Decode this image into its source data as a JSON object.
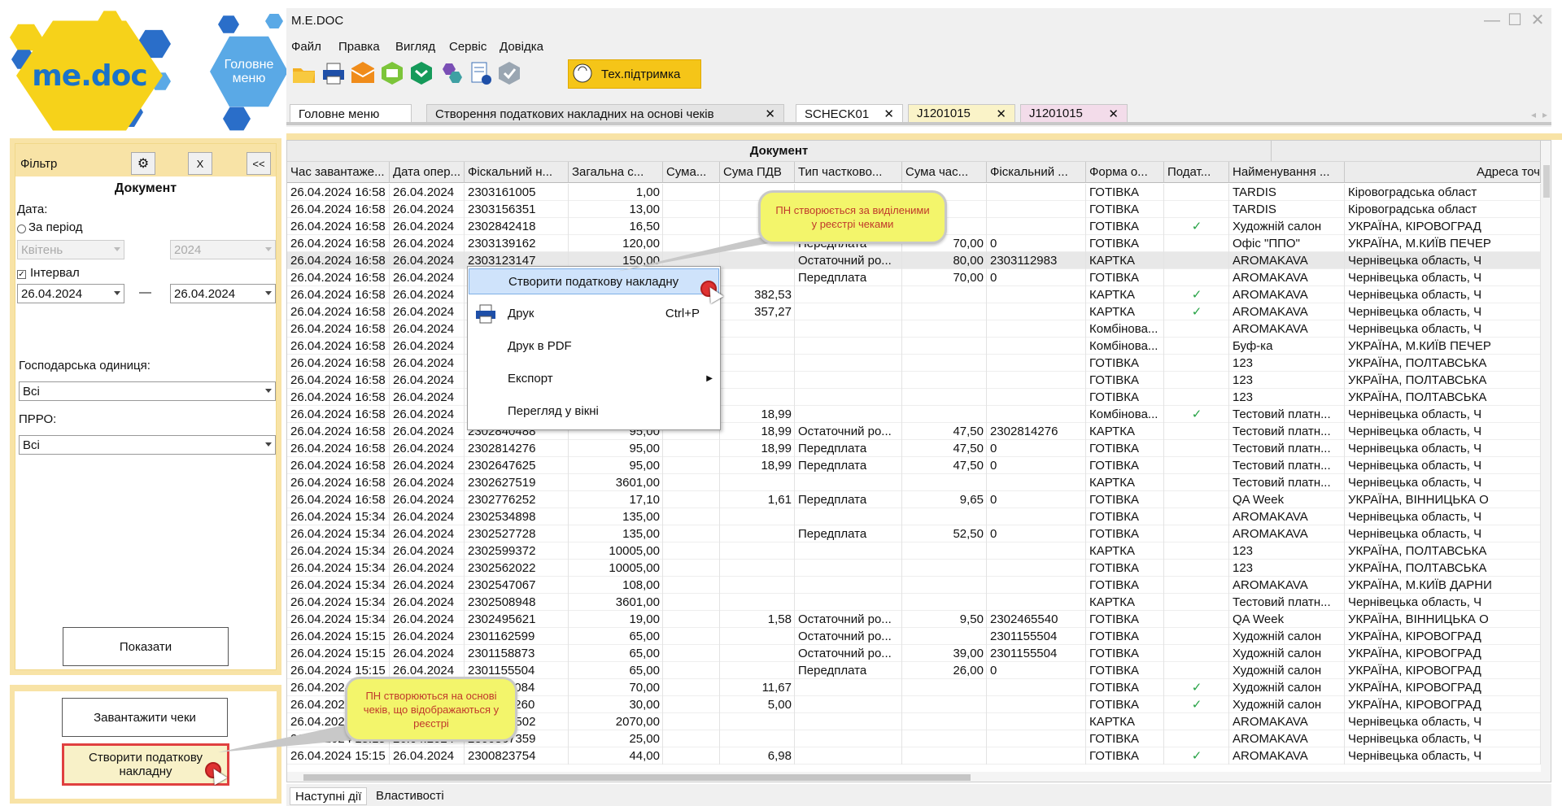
{
  "logo": {
    "text": "me.doc",
    "home_label": "Головне меню"
  },
  "filter": {
    "title": "Фільтр",
    "reset_label": "X",
    "collapse_label": "<<",
    "section": "Документ",
    "date_label": "Дата:",
    "period_label": "За період",
    "month_value": "Квітень",
    "year_value": "2024",
    "interval_label": "Інтервал",
    "date_from": "26.04.2024",
    "date_dash": "—",
    "date_to": "26.04.2024",
    "unit_label": "Господарська одиниця:",
    "unit_value": "Всі",
    "prro_label": "ПРРО:",
    "prro_value": "Всі",
    "show_button": "Показати"
  },
  "bottom_actions": {
    "load_button": "Завантажити чеки",
    "create_button": "Створити податкову накладну"
  },
  "window": {
    "title": "M.E.DOC",
    "menu": [
      "Файл",
      "Правка",
      "Вигляд",
      "Сервіс",
      "Довідка"
    ],
    "support_label": "Тех.підтримка",
    "tabs": [
      "Головне меню",
      "Створення податкових накладних на основі чеків",
      "SCHECK01",
      "J1201015",
      "J1201015"
    ],
    "bottom_tabs": [
      "Наступні дії",
      "Властивості"
    ]
  },
  "toolbar_icons": [
    "open-folder-icon",
    "print-icon",
    "envelope-icon",
    "email-green-icon",
    "inbox-green-icon",
    "hexagon-cluster-icon",
    "document-settings-icon",
    "shield-check-icon",
    "support-chat-icon"
  ],
  "grid": {
    "group_header": "Документ",
    "headers": [
      "Час завантаже...",
      "Дата опер...",
      "Фіскальний н...",
      "Загальна с...",
      "Сума...",
      "Сума ПДВ",
      "Тип частково...",
      "Сума час...",
      "Фіскальний ...",
      "Форма о...",
      "Подат...",
      "Найменування ...",
      "Адреса точ"
    ],
    "rows": [
      [
        "26.04.2024 16:58",
        "26.04.2024",
        "2303161005",
        "1,00",
        "",
        "",
        "",
        "",
        "",
        "ГОТІВКА",
        "",
        "TARDIS",
        "Кіровоградська област"
      ],
      [
        "26.04.2024 16:58",
        "26.04.2024",
        "2303156351",
        "13,00",
        "",
        "",
        "",
        "",
        "",
        "ГОТІВКА",
        "",
        "TARDIS",
        "Кіровоградська област"
      ],
      [
        "26.04.2024 16:58",
        "26.04.2024",
        "2302842418",
        "16,50",
        "",
        "",
        "",
        "",
        "",
        "ГОТІВКА",
        "✓",
        "Художній салон",
        "УКРАЇНА, КІРОВОГРАД"
      ],
      [
        "26.04.2024 16:58",
        "26.04.2024",
        "2303139162",
        "120,00",
        "",
        "",
        "Передплата",
        "70,00",
        "0",
        "ГОТІВКА",
        "",
        "Офіс \"ППО\"",
        "УКРАЇНА, М.КИЇВ ПЕЧЕР"
      ],
      [
        "26.04.2024 16:58",
        "26.04.2024",
        "2303123147",
        "150,00",
        "",
        "",
        "Остаточний ро...",
        "80,00",
        "2303112983",
        "КАРТКА",
        "",
        "AROMAKAVA",
        "Чернівецька область, Ч"
      ],
      [
        "26.04.2024 16:58",
        "26.04.2024",
        "",
        "",
        "",
        "",
        "Передплата",
        "70,00",
        "0",
        "ГОТІВКА",
        "",
        "AROMAKAVA",
        "Чернівецька область, Ч"
      ],
      [
        "26.04.2024 16:58",
        "26.04.2024",
        "",
        "",
        "",
        "382,53",
        "",
        "",
        "",
        "КАРТКА",
        "✓",
        "AROMAKAVA",
        "Чернівецька область, Ч"
      ],
      [
        "26.04.2024 16:58",
        "26.04.2024",
        "",
        "",
        "",
        "357,27",
        "",
        "",
        "",
        "КАРТКА",
        "✓",
        "AROMAKAVA",
        "Чернівецька область, Ч"
      ],
      [
        "26.04.2024 16:58",
        "26.04.2024",
        "",
        "",
        "",
        "",
        "",
        "",
        "",
        "Комбінова...",
        "",
        "AROMAKAVA",
        "Чернівецька область, Ч"
      ],
      [
        "26.04.2024 16:58",
        "26.04.2024",
        "",
        "",
        "",
        "",
        "",
        "",
        "",
        "Комбінова...",
        "",
        "Буф-ка",
        "УКРАЇНА, М.КИЇВ ПЕЧЕР"
      ],
      [
        "26.04.2024 16:58",
        "26.04.2024",
        "",
        "",
        "",
        "",
        "",
        "",
        "",
        "ГОТІВКА",
        "",
        "123",
        "УКРАЇНА, ПОЛТАВСЬКА"
      ],
      [
        "26.04.2024 16:58",
        "26.04.2024",
        "",
        "",
        "",
        "",
        "",
        "",
        "",
        "ГОТІВКА",
        "",
        "123",
        "УКРАЇНА, ПОЛТАВСЬКА"
      ],
      [
        "26.04.2024 16:58",
        "26.04.2024",
        "",
        "",
        "",
        "",
        "",
        "",
        "",
        "ГОТІВКА",
        "",
        "123",
        "УКРАЇНА, ПОЛТАВСЬКА"
      ],
      [
        "26.04.2024 16:58",
        "26.04.2024",
        "",
        "",
        "",
        "18,99",
        "",
        "",
        "",
        "Комбінова...",
        "✓",
        "Тестовий платн...",
        "Чернівецька область, Ч"
      ],
      [
        "26.04.2024 16:58",
        "26.04.2024",
        "2302840488",
        "95,00",
        "",
        "18,99",
        "Остаточний ро...",
        "47,50",
        "2302814276",
        "КАРТКА",
        "",
        "Тестовий платн...",
        "Чернівецька область, Ч"
      ],
      [
        "26.04.2024 16:58",
        "26.04.2024",
        "2302814276",
        "95,00",
        "",
        "18,99",
        "Передплата",
        "47,50",
        "0",
        "ГОТІВКА",
        "",
        "Тестовий платн...",
        "Чернівецька область, Ч"
      ],
      [
        "26.04.2024 16:58",
        "26.04.2024",
        "2302647625",
        "95,00",
        "",
        "18,99",
        "Передплата",
        "47,50",
        "0",
        "ГОТІВКА",
        "",
        "Тестовий платн...",
        "Чернівецька область, Ч"
      ],
      [
        "26.04.2024 16:58",
        "26.04.2024",
        "2302627519",
        "3601,00",
        "",
        "",
        "",
        "",
        "",
        "КАРТКА",
        "",
        "Тестовий платн...",
        "Чернівецька область, Ч"
      ],
      [
        "26.04.2024 16:58",
        "26.04.2024",
        "2302776252",
        "17,10",
        "",
        "1,61",
        "Передплата",
        "9,65",
        "0",
        "ГОТІВКА",
        "",
        "QA Week",
        "УКРАЇНА, ВІННИЦЬКА О"
      ],
      [
        "26.04.2024 15:34",
        "26.04.2024",
        "2302534898",
        "135,00",
        "",
        "",
        "",
        "",
        "",
        "ГОТІВКА",
        "",
        "AROMAKAVA",
        "Чернівецька область, Ч"
      ],
      [
        "26.04.2024 15:34",
        "26.04.2024",
        "2302527728",
        "135,00",
        "",
        "",
        "Передплата",
        "52,50",
        "0",
        "ГОТІВКА",
        "",
        "AROMAKAVA",
        "Чернівецька область, Ч"
      ],
      [
        "26.04.2024 15:34",
        "26.04.2024",
        "2302599372",
        "10005,00",
        "",
        "",
        "",
        "",
        "",
        "КАРТКА",
        "",
        "123",
        "УКРАЇНА, ПОЛТАВСЬКА"
      ],
      [
        "26.04.2024 15:34",
        "26.04.2024",
        "2302562022",
        "10005,00",
        "",
        "",
        "",
        "",
        "",
        "ГОТІВКА",
        "",
        "123",
        "УКРАЇНА, ПОЛТАВСЬКА"
      ],
      [
        "26.04.2024 15:34",
        "26.04.2024",
        "2302547067",
        "108,00",
        "",
        "",
        "",
        "",
        "",
        "ГОТІВКА",
        "",
        "AROMAKAVA",
        "УКРАЇНА, М.КИЇВ ДАРНИ"
      ],
      [
        "26.04.2024 15:34",
        "26.04.2024",
        "2302508948",
        "3601,00",
        "",
        "",
        "",
        "",
        "",
        "КАРТКА",
        "",
        "Тестовий платн...",
        "Чернівецька область, Ч"
      ],
      [
        "26.04.2024 15:34",
        "26.04.2024",
        "2302495621",
        "19,00",
        "",
        "1,58",
        "Остаточний ро...",
        "9,50",
        "2302465540",
        "ГОТІВКА",
        "",
        "QA Week",
        "УКРАЇНА, ВІННИЦЬКА О"
      ],
      [
        "26.04.2024 15:15",
        "26.04.2024",
        "2301162599",
        "65,00",
        "",
        "",
        "Остаточний ро...",
        "",
        "2301155504",
        "ГОТІВКА",
        "",
        "Художній салон",
        "УКРАЇНА, КІРОВОГРАД"
      ],
      [
        "26.04.2024 15:15",
        "26.04.2024",
        "2301158873",
        "65,00",
        "",
        "",
        "Остаточний ро...",
        "39,00",
        "2301155504",
        "ГОТІВКА",
        "",
        "Художній салон",
        "УКРАЇНА, КІРОВОГРАД"
      ],
      [
        "26.04.2024 15:15",
        "26.04.2024",
        "2301155504",
        "65,00",
        "",
        "",
        "Передплата",
        "26,00",
        "0",
        "ГОТІВКА",
        "",
        "Художній салон",
        "УКРАЇНА, КІРОВОГРАД"
      ],
      [
        "26.04.2024 15:15",
        "26.04.2024",
        "2301144084",
        "70,00",
        "",
        "11,67",
        "",
        "",
        "",
        "ГОТІВКА",
        "✓",
        "Художній салон",
        "УКРАЇНА, КІРОВОГРАД"
      ],
      [
        "26.04.2024 15:15",
        "26.04.2024",
        "2301141260",
        "30,00",
        "",
        "5,00",
        "",
        "",
        "",
        "ГОТІВКА",
        "✓",
        "Художній салон",
        "УКРАЇНА, КІРОВОГРАД"
      ],
      [
        "26.04.2024 15:15",
        "26.04.2024",
        "2301785502",
        "2070,00",
        "",
        "",
        "",
        "",
        "",
        "КАРТКА",
        "",
        "AROMAKAVA",
        "Чернівецька область, Ч"
      ],
      [
        "26.04.2024 15:15",
        "26.04.2024",
        "2300867359",
        "25,00",
        "",
        "",
        "",
        "",
        "",
        "ГОТІВКА",
        "",
        "AROMAKAVA",
        "Чернівецька область, Ч"
      ],
      [
        "26.04.2024 15:15",
        "26.04.2024",
        "2300823754",
        "44,00",
        "",
        "6,98",
        "",
        "",
        "",
        "ГОТІВКА",
        "✓",
        "AROMAKAVA",
        "Чернівецька область, Ч"
      ]
    ]
  },
  "context_menu": {
    "items": [
      {
        "label": "Створити податкову накладну",
        "shortcut": ""
      },
      {
        "label": "Друк",
        "shortcut": "Ctrl+P"
      },
      {
        "label": "Друк в PDF",
        "shortcut": ""
      },
      {
        "label": "Експорт",
        "shortcut": ""
      },
      {
        "label": "Перегляд у вікні",
        "shortcut": ""
      }
    ]
  },
  "callouts": {
    "top": "ПН створюється за виділеними у реєстрі чеками",
    "bottom": "ПН створюються на основі чеків, що відображаються у реєстрі"
  },
  "colors": {
    "accent_yellow": "#f5c518",
    "panel_beige": "#f8e3a6",
    "selection_blue": "#cfe3fb",
    "check_green": "#25a244",
    "callout_yellow": "#f3f56b",
    "callout_text": "#c0392b"
  }
}
